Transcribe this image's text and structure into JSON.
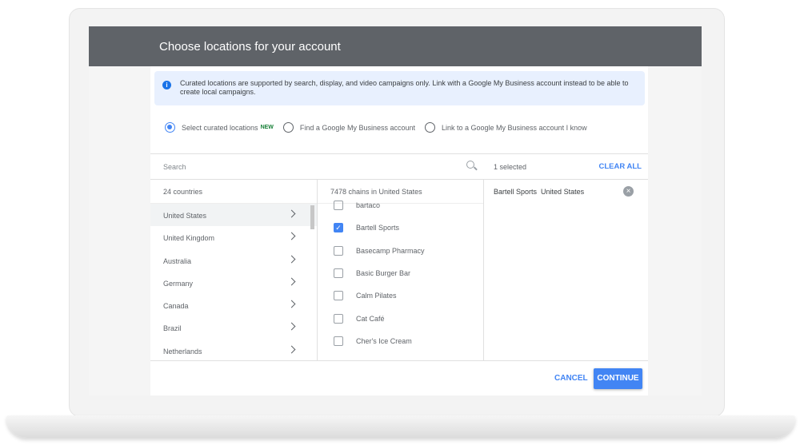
{
  "dialog": {
    "title": "Choose locations for your account",
    "info": "Curated locations are supported by search, display, and video campaigns only. Link with a Google My Business account instead to be able to create local campaigns.",
    "info_icon": "i",
    "radios": [
      {
        "label": "Select curated locations",
        "badge": "NEW",
        "selected": true
      },
      {
        "label": "Find a Google My Business account",
        "selected": false
      },
      {
        "label": "Link to a Google My Business account I know",
        "selected": false
      }
    ],
    "search_placeholder": "Search",
    "countries_header": "24 countries",
    "countries": [
      "United States",
      "United Kingdom",
      "Australia",
      "Germany",
      "Canada",
      "Brazil",
      "Netherlands"
    ],
    "chains_header": "7478 chains in United States",
    "chains": [
      {
        "name": "bartaco",
        "checked": false
      },
      {
        "name": "Bartell Sports",
        "checked": true
      },
      {
        "name": "Basecamp Pharmacy",
        "checked": false
      },
      {
        "name": "Basic Burger Bar",
        "checked": false
      },
      {
        "name": "Calm Pilates",
        "checked": false
      },
      {
        "name": "Cat Café",
        "checked": false
      },
      {
        "name": "Cher's Ice Cream",
        "checked": false
      }
    ],
    "selected_count": "1 selected",
    "clear_all": "CLEAR ALL",
    "selected_item": {
      "name": "Bartell Sports",
      "country": "United States"
    },
    "cancel": "CANCEL",
    "continue": "CONTINUE",
    "accent": "#4285f4"
  }
}
